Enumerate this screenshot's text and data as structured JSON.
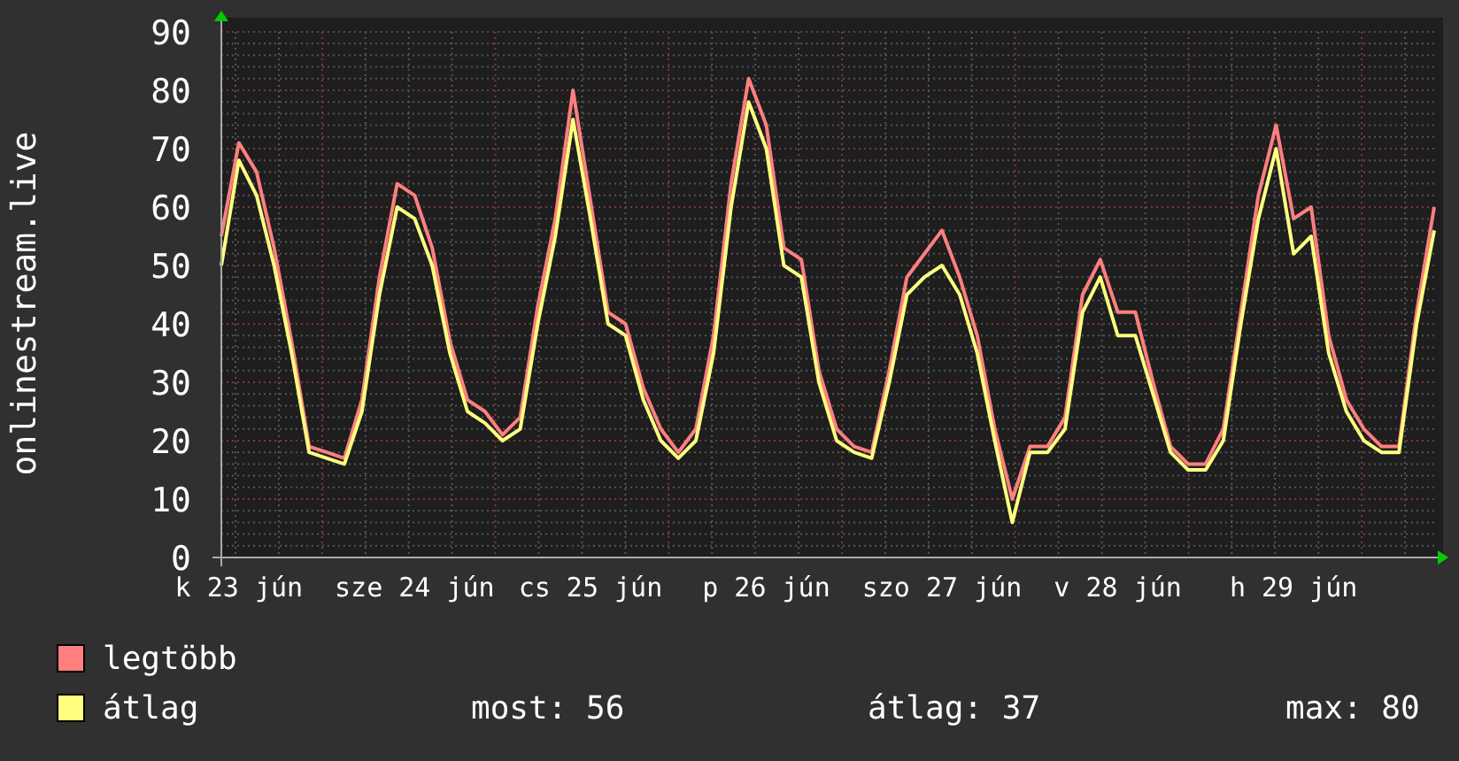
{
  "chart": {
    "chart_data": {
      "type": "line",
      "ylabel": "onlinestream.live",
      "grid": true,
      "ylim": [
        0,
        90
      ],
      "yticks": [
        0,
        10,
        20,
        30,
        40,
        50,
        60,
        70,
        80,
        90
      ],
      "categories": [
        null,
        "k 23 jún",
        null,
        null,
        null,
        null,
        null,
        null,
        null,
        null,
        null,
        "sze 24 jún",
        null,
        null,
        null,
        null,
        null,
        null,
        null,
        null,
        null,
        "cs 25 jún",
        null,
        null,
        null,
        null,
        null,
        null,
        null,
        null,
        null,
        "p 26 jún",
        null,
        null,
        null,
        null,
        null,
        null,
        null,
        null,
        null,
        "szo 27 jún",
        null,
        null,
        null,
        null,
        null,
        null,
        null,
        null,
        null,
        "v 28 jún",
        null,
        null,
        null,
        null,
        null,
        null,
        null,
        null,
        null,
        "h 29 jún",
        null,
        null,
        null,
        null,
        null,
        null,
        null,
        null
      ],
      "series": [
        {
          "name": "legtöbb",
          "color": "#ff7f7f",
          "values": [
            55,
            71,
            66,
            53,
            37,
            19,
            18,
            17,
            27,
            48,
            64,
            62,
            53,
            37,
            27,
            25,
            21,
            24,
            43,
            58,
            80,
            61,
            42,
            40,
            29,
            22,
            18,
            22,
            38,
            64,
            82,
            74,
            53,
            51,
            32,
            22,
            19,
            18,
            32,
            48,
            52,
            56,
            48,
            38,
            22,
            10,
            19,
            19,
            24,
            45,
            51,
            42,
            42,
            30,
            19,
            16,
            16,
            22,
            42,
            62,
            74,
            58,
            60,
            38,
            27,
            22,
            19,
            19,
            42,
            60
          ]
        },
        {
          "name": "átlag",
          "color": "#ffff7f",
          "values": [
            50,
            68,
            62,
            50,
            35,
            18,
            17,
            16,
            25,
            45,
            60,
            58,
            50,
            35,
            25,
            23,
            20,
            22,
            40,
            55,
            75,
            58,
            40,
            38,
            27,
            20,
            17,
            20,
            35,
            60,
            78,
            70,
            50,
            48,
            30,
            20,
            18,
            17,
            30,
            45,
            48,
            50,
            45,
            35,
            20,
            6,
            18,
            18,
            22,
            42,
            48,
            38,
            38,
            28,
            18,
            15,
            15,
            20,
            40,
            58,
            70,
            52,
            55,
            35,
            25,
            20,
            18,
            18,
            40,
            56
          ]
        }
      ]
    }
  },
  "stats": [
    "most: 56",
    "átlag: 37",
    "max: 80"
  ]
}
